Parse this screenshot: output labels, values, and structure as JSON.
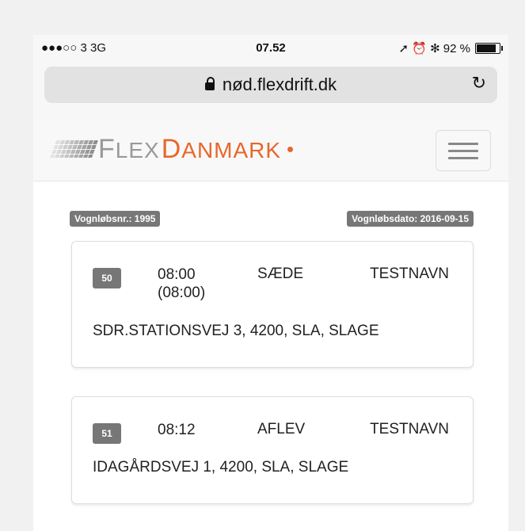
{
  "status_bar": {
    "carrier": "●●●○○ 3  3G",
    "time": "07.52",
    "indicators": "➚ ⏰ ✻ 92 %",
    "battery_percent": 92
  },
  "browser": {
    "url": "nød.flexdrift.dk",
    "reload_icon": "reload-icon"
  },
  "navbar": {
    "logo_flex_first": "F",
    "logo_flex_rest": "LEX",
    "logo_dk_first": "D",
    "logo_dk_rest": "ANMARK",
    "accent_color": "#e8672a",
    "menu_icon": "hamburger-icon"
  },
  "header": {
    "route_label": "Vognløbsnr.: 1995",
    "date_label": "Vognløbsdato: 2016-09-15"
  },
  "stops": [
    {
      "number": "50",
      "time": "08:00",
      "planned": "(08:00)",
      "action": "SÆDE",
      "name": "TESTNAVN",
      "address": "SDR.STATIONSVEJ 3, 4200, SLA, SLAGE"
    },
    {
      "number": "51",
      "time": "08:12",
      "action": "AFLEV",
      "name": "TESTNAVN",
      "address": "IDAGÅRDSVEJ 1, 4200, SLA, SLAGE"
    }
  ]
}
